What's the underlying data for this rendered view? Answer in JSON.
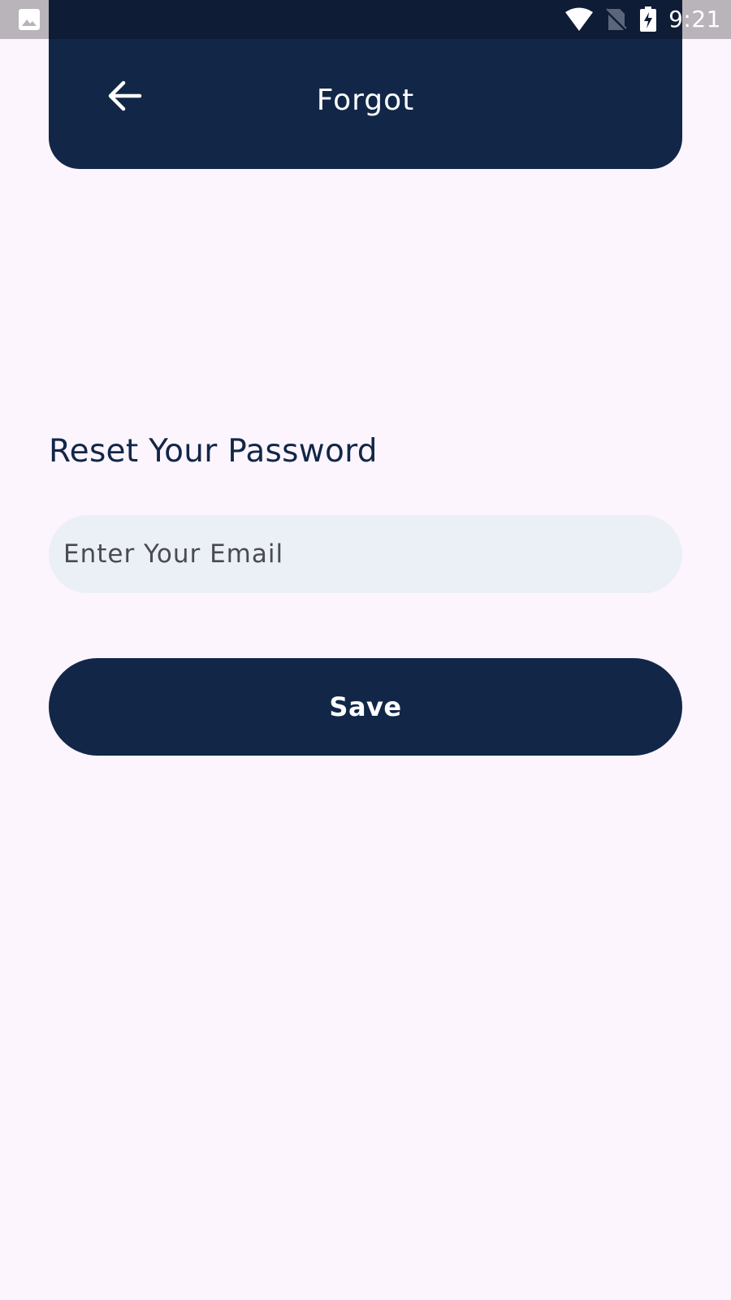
{
  "status_bar": {
    "time": "9:21",
    "icons": [
      "image-icon",
      "wifi-icon",
      "no-sim-icon",
      "battery-charging-icon"
    ]
  },
  "header": {
    "title": "Forgot",
    "back_icon": "arrow-left-icon"
  },
  "main": {
    "title": "Reset Your Password",
    "email_input": {
      "placeholder": "Enter Your Email",
      "value": ""
    },
    "save_label": "Save"
  },
  "colors": {
    "background": "#fcf5fd",
    "primary": "#122748",
    "input_bg": "#ebeff6",
    "text_on_primary": "#ffffff"
  }
}
